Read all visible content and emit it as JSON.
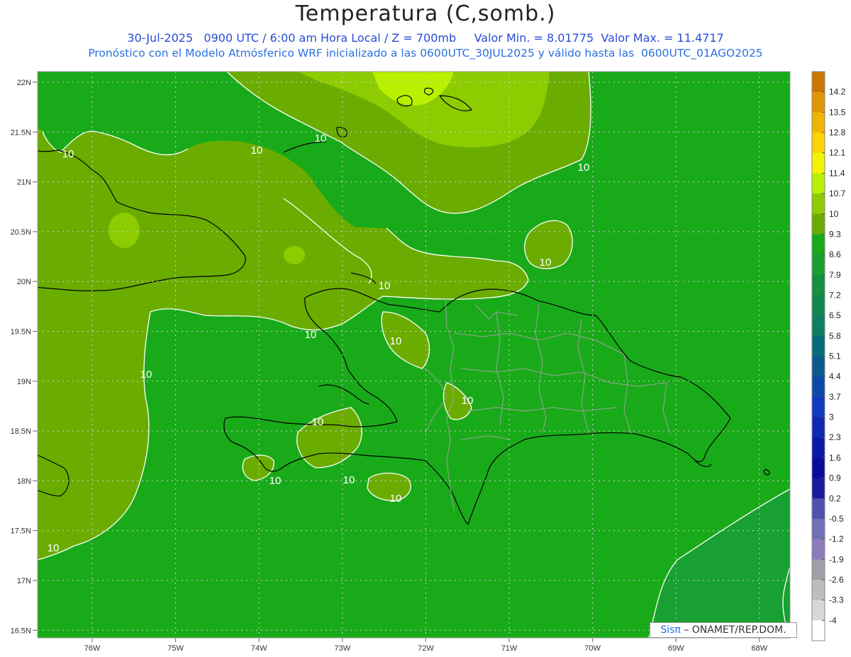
{
  "header": {
    "title": "Temperatura (C,somb.)",
    "date": "30-Jul-2025",
    "time": "0900 UTC / 6:00 am Hora Local / Z = 700mb",
    "min": "Valor Min. = 8.01775",
    "max": "Valor Max. = 11.4717",
    "forecast_line": "Pronóstico con el Modelo Atmósferico WRF inicializado a las 0600UTC_30JUL2025 y válido hasta las  0600UTC_01AGO2025"
  },
  "map": {
    "lat_labels": [
      "22N",
      "21.5N",
      "21N",
      "20.5N",
      "20N",
      "19.5N",
      "19N",
      "18.5N",
      "18N",
      "17.5N",
      "17N",
      "16.5N"
    ],
    "lon_labels": [
      "76W",
      "75W",
      "74W",
      "73W",
      "72W",
      "71W",
      "70W",
      "69W",
      "68W"
    ],
    "contour_label": "10",
    "colors": {
      "t9": "#19aa19",
      "t10": "#6aad00",
      "t10_7": "#8ccc00",
      "t11_4": "#b8f000",
      "t8_6": "#18a032",
      "coast": "#000000",
      "border": "#a0a0a0",
      "contour": "#ffffff"
    }
  },
  "legend": {
    "values": [
      "14.2",
      "13.5",
      "12.8",
      "12.1",
      "11.4",
      "10.7",
      "10",
      "9.3",
      "8.6",
      "7.9",
      "7.2",
      "6.5",
      "5.8",
      "5.1",
      "4.4",
      "3.7",
      "3",
      "2.3",
      "1.6",
      "0.9",
      "0.2",
      "-0.5",
      "-1.2",
      "-1.9",
      "-2.6",
      "-3.3",
      "-4"
    ],
    "colors": [
      "#c87800",
      "#e09600",
      "#f0b400",
      "#ffd200",
      "#f4f400",
      "#b8f000",
      "#8ccc00",
      "#6aad00",
      "#19aa19",
      "#18a032",
      "#149040",
      "#10884e",
      "#0c8060",
      "#086c78",
      "#0a5a90",
      "#0c4aaa",
      "#1038c0",
      "#0c28b4",
      "#0a18a8",
      "#0a0a9c",
      "#1a1aa0",
      "#5050b0",
      "#7070b8",
      "#8c7cbc",
      "#a0a0a8",
      "#bdbdbd",
      "#d8d8d8",
      "#ffffff"
    ]
  },
  "credit": {
    "sis": "Sisπ",
    "org": "– ONAMET/REP.DOM."
  }
}
